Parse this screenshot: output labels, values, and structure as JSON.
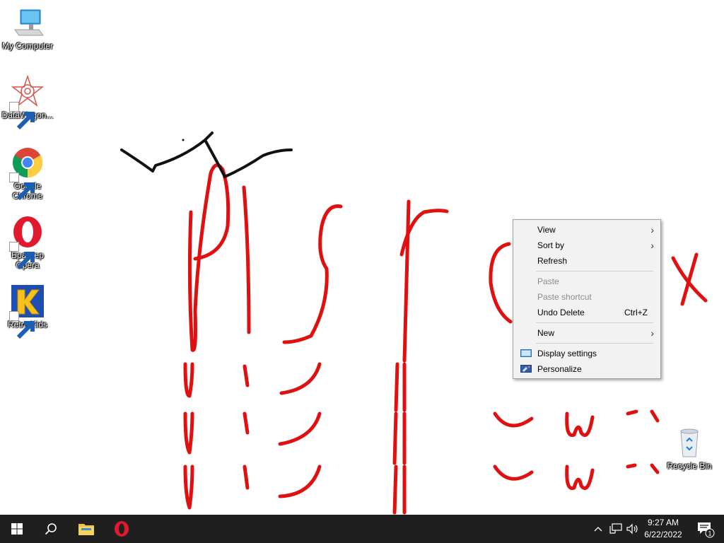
{
  "desktop": {
    "icons": [
      {
        "label": "My Computer"
      },
      {
        "label": "DataWagon..."
      },
      {
        "label": "Google Chrome"
      },
      {
        "label": "Браузер Opera"
      },
      {
        "label": "Retro Kids"
      },
      {
        "label": "Recycle Bin"
      }
    ]
  },
  "context_menu": {
    "view": "View",
    "sort_by": "Sort by",
    "refresh": "Refresh",
    "paste": "Paste",
    "paste_shortcut": "Paste shortcut",
    "undo_delete": "Undo Delete",
    "undo_delete_accel": "Ctrl+Z",
    "new": "New",
    "display_settings": "Display settings",
    "personalize": "Personalize"
  },
  "taskbar": {
    "time": "9:27 AM",
    "date": "6/22/2022",
    "notification_count": "1"
  }
}
